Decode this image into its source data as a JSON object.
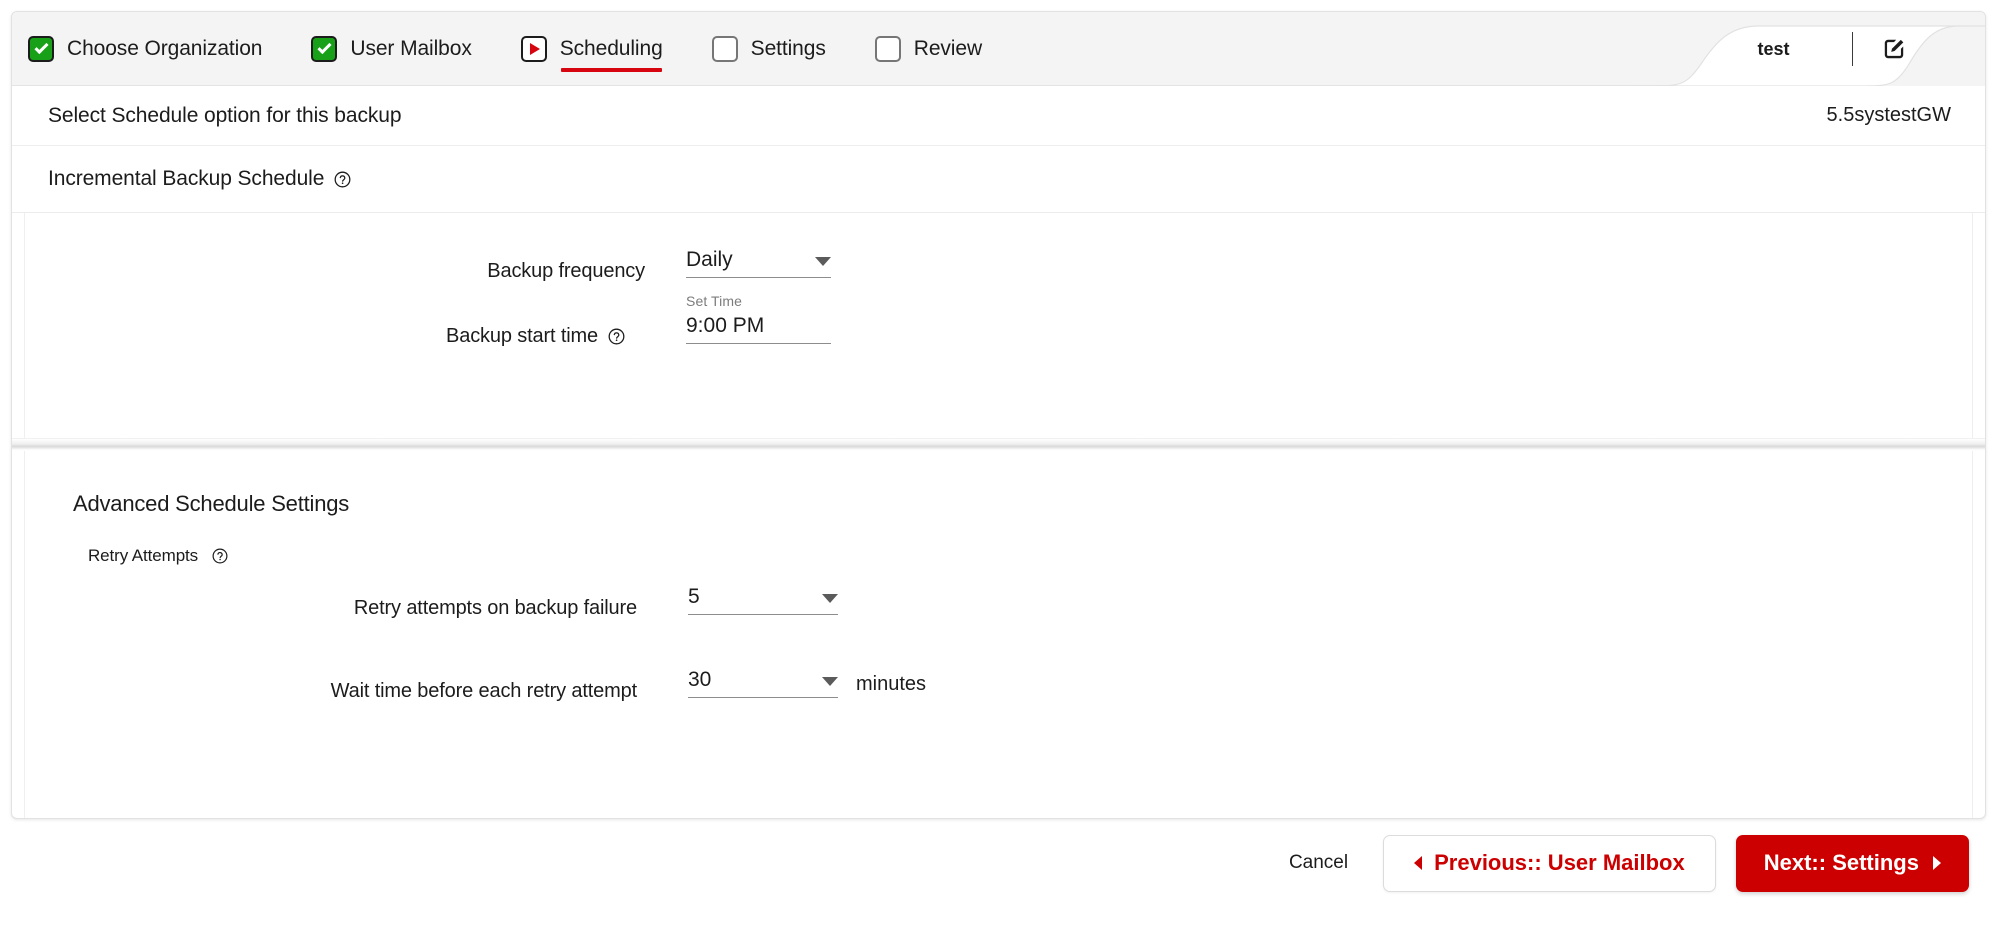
{
  "wizard": {
    "steps": [
      {
        "label": "Choose Organization",
        "state": "done",
        "icon": "checkbox-checked-icon"
      },
      {
        "label": "User Mailbox",
        "state": "done",
        "icon": "checkbox-checked-icon"
      },
      {
        "label": "Scheduling",
        "state": "current",
        "icon": "play-icon"
      },
      {
        "label": "Settings",
        "state": "todo",
        "icon": "checkbox-empty-icon"
      },
      {
        "label": "Review",
        "state": "todo",
        "icon": "checkbox-empty-icon"
      }
    ],
    "profile": {
      "name": "test",
      "edit_icon": "edit-pencil-icon"
    }
  },
  "header": {
    "title": "Select Schedule option for this backup",
    "environment": "5.5systestGW"
  },
  "section": {
    "title": "Incremental Backup Schedule",
    "help_icon": "help-circle-icon"
  },
  "form": {
    "backup_frequency": {
      "label": "Backup frequency",
      "value": "Daily",
      "options": [
        "Daily"
      ],
      "caret_icon": "chevron-down-icon"
    },
    "backup_start_time": {
      "label": "Backup start time",
      "help_icon": "help-circle-icon",
      "float_label": "Set Time",
      "value": "9:00 PM"
    }
  },
  "advanced": {
    "title": "Advanced Schedule Settings",
    "subsection": {
      "title": "Retry Attempts",
      "help_icon": "help-circle-icon"
    },
    "retry_attempts": {
      "label": "Retry attempts on backup failure",
      "value": "5",
      "options": [
        "5"
      ],
      "caret_icon": "chevron-down-icon"
    },
    "wait_time": {
      "label": "Wait time before each retry attempt",
      "value": "30",
      "options": [
        "30"
      ],
      "unit": "minutes",
      "caret_icon": "chevron-down-icon"
    }
  },
  "footer": {
    "cancel": "Cancel",
    "previous": "Previous:: User Mailbox",
    "next": "Next:: Settings"
  },
  "colors": {
    "brand_red": "#cc0000",
    "accent_red": "#d60510",
    "done_green": "#18a118",
    "tab_strip_bg": "#f4f4f4",
    "text": "#1c1c1c",
    "muted": "#7c7c7c"
  }
}
